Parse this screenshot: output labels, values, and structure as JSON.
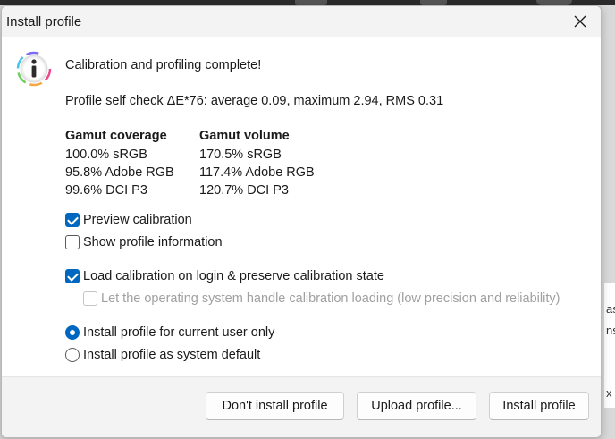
{
  "dialog": {
    "title": "Install profile",
    "heading": "Calibration and profiling complete!",
    "self_check": "Profile self check ΔE*76: average 0.09, maximum 2.94, RMS 0.31",
    "coverage": {
      "header": "Gamut coverage",
      "rows": [
        "100.0% sRGB",
        "95.8% Adobe RGB",
        "99.6% DCI P3"
      ]
    },
    "volume": {
      "header": "Gamut volume",
      "rows": [
        "170.5% sRGB",
        "117.4% Adobe RGB",
        "120.7% DCI P3"
      ]
    },
    "options": {
      "preview_calibration": {
        "label": "Preview calibration",
        "checked": true
      },
      "show_profile_info": {
        "label": "Show profile information",
        "checked": false
      },
      "load_calibration": {
        "label": "Load calibration on login & preserve calibration state",
        "checked": true
      },
      "os_handle": {
        "label": "Let the operating system handle calibration loading (low precision and reliability)",
        "checked": false,
        "enabled": false
      }
    },
    "install_scope": {
      "current_user": {
        "label": "Install profile for current user only",
        "selected": true
      },
      "system_default": {
        "label": "Install profile as system default",
        "selected": false
      }
    },
    "buttons": {
      "dont_install": "Don't install profile",
      "upload": "Upload profile...",
      "install": "Install profile"
    }
  },
  "background": {
    "right_fragments": [
      "as",
      "ns",
      "x"
    ]
  },
  "colors": {
    "accent": "#0067c0",
    "titlebar": "#f3f3f3"
  }
}
